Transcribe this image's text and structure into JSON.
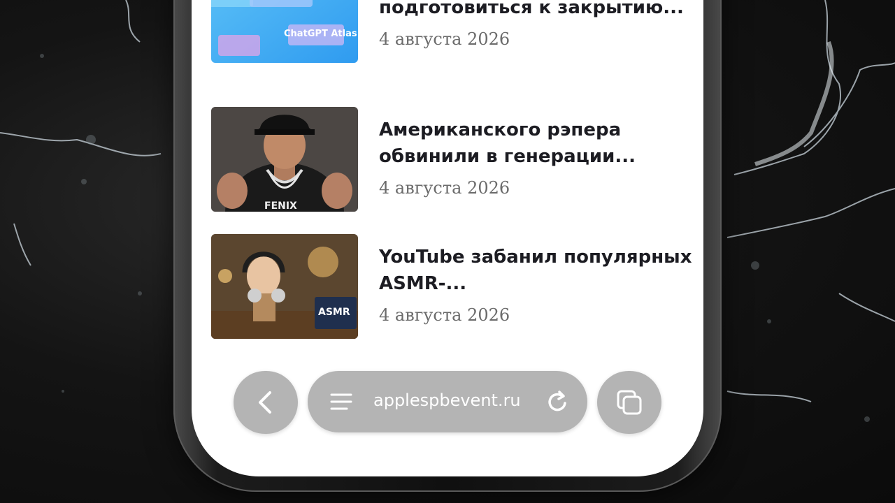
{
  "articles": [
    {
      "title": "OpenAI объяснила, как подготовиться к закрытию...",
      "date": "4 августа 2026",
      "thumb_text": "ChatGPT Atlas"
    },
    {
      "title": "Американского рэпера обвинили в генерации...",
      "date": "4 августа 2026",
      "thumb_text": ""
    },
    {
      "title": "YouTube забанил популярных ASMR-...",
      "date": "4 августа 2026",
      "thumb_text": "ASMR"
    }
  ],
  "toolbar": {
    "url": "applespbevent.ru",
    "back_icon": "chevron-left-icon",
    "menu_icon": "menu-icon",
    "reload_icon": "reload-icon",
    "tabs_icon": "tabs-icon"
  },
  "colors": {
    "title": "#1c1c22",
    "date": "#6b6b6b",
    "toolbar_bg": "#b4b4b4",
    "screen_bg": "#ffffff"
  }
}
